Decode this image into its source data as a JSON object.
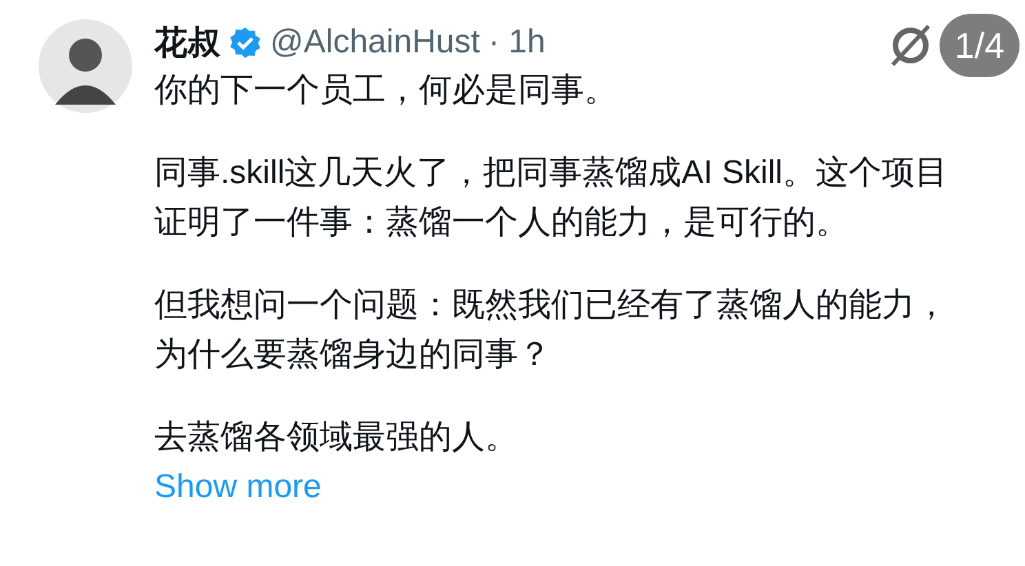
{
  "author": {
    "name": "花叔",
    "verified": true,
    "handle": "@AlchainHust",
    "time": "· 1h"
  },
  "paragraphs": [
    "你的下一个员工，何必是同事。",
    "同事.skill这几天火了，把同事蒸馏成AI Skill。这个项目证明了一件事：蒸馏一个人的能力，是可行的。",
    "但我想问一个问题：既然我们已经有了蒸馏人的能力，为什么要蒸馏身边的同事？",
    "去蒸馏各领域最强的人。"
  ],
  "show_more": "Show more",
  "page_indicator": "1/4"
}
